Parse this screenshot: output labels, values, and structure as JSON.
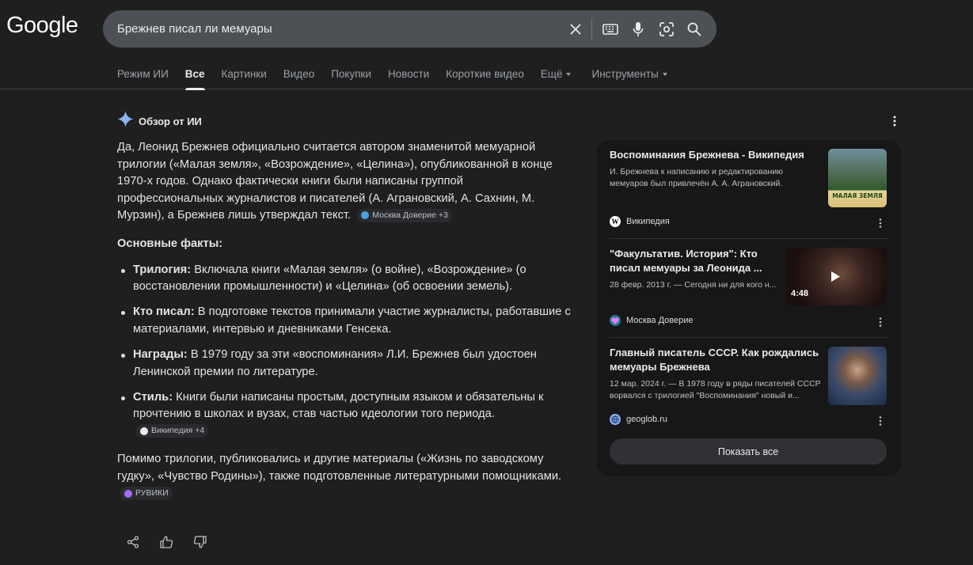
{
  "logo": "Google",
  "search": {
    "query": "Брежнев писал ли мемуары"
  },
  "tabs": [
    {
      "label": "Режим ИИ",
      "active": false
    },
    {
      "label": "Все",
      "active": true
    },
    {
      "label": "Картинки",
      "active": false
    },
    {
      "label": "Видео",
      "active": false
    },
    {
      "label": "Покупки",
      "active": false
    },
    {
      "label": "Новости",
      "active": false
    },
    {
      "label": "Короткие видео",
      "active": false
    },
    {
      "label": "Ещё",
      "active": false
    },
    {
      "label": "Инструменты",
      "active": false
    }
  ],
  "ai_overview": {
    "title": "Обзор от ИИ",
    "intro": "Да, Леонид Брежнев официально считается автором знаменитой мемуарной трилогии («Малая земля», «Возрождение», «Целина»), опубликованной в конце 1970-х годов. Однако фактически книги были написаны группой профессиональных журналистов и писателей (А. Аграновский, А. Сахнин, М. Мурзин), а Брежнев лишь утверждал текст.",
    "intro_cite": "Москва Доверие +3",
    "facts_heading": "Основные факты:",
    "facts": [
      {
        "label": "Трилогия:",
        "text": " Включала книги «Малая земля» (о войне), «Возрождение» (о восстановлении промышленности) и «Целина» (об освоении земель)."
      },
      {
        "label": "Кто писал:",
        "text": " В подготовке текстов принимали участие журналисты, работавшие с материалами, интервью и дневниками Генсека."
      },
      {
        "label": "Награды:",
        "text": " В 1979 году за эти «воспоминания» Л.И. Брежнев был удостоен Ленинской премии по литературе."
      },
      {
        "label": "Стиль:",
        "text": " Книги были написаны простым, доступным языком и обязательны к прочтению в школах и вузах, став частью идеологии того периода."
      }
    ],
    "facts_cite": "Википедия +4",
    "outro": "Помимо трилогии, публиковались и другие материалы («Жизнь по заводскому гудку», «Чувство Родины»), также подготовленные литературными помощниками.",
    "outro_cite": "РУВИКИ"
  },
  "sources": [
    {
      "title": "Воспоминания Брежнева - Википедия",
      "snippet": "И. Брежнева к написанию и редактированию мемуаров был привлечён А. А. Аграновский.",
      "site": "Википедия",
      "thumb_text": "МАЛАЯ ЗЕМЛЯ"
    },
    {
      "title": "\"Факультатив. История\": Кто писал мемуары за Леонида ...",
      "snippet": "28 февр. 2013 г. — Сегодня ни для кого н...",
      "site": "Москва Доверие",
      "duration": "4:48"
    },
    {
      "title": "Главный писатель СССР. Как рождались мемуары Брежнева",
      "snippet": "12 мар. 2024 г. — В 1978 году в ряды писателей СССР ворвался с трилогией \"Воспоминания\" новый и...",
      "site": "geoglob.ru"
    }
  ],
  "show_all": "Показать все",
  "colors": {
    "background": "#1f1f1f",
    "panel": "#171717",
    "search": "#4d5156",
    "accent_sparkle": "#8ab4f8"
  }
}
